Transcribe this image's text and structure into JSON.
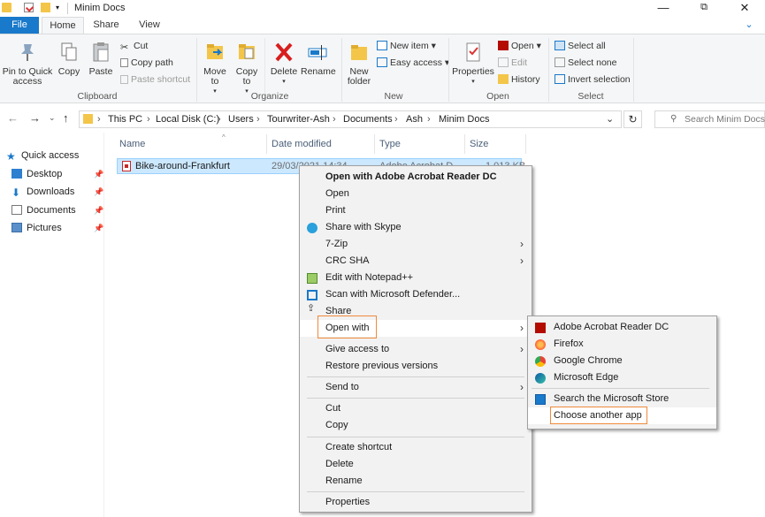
{
  "window": {
    "title": "Minim Docs",
    "controls": {
      "minimize": "—",
      "maximize": "⧉",
      "close": "✕"
    }
  },
  "tabs": [
    "File",
    "Home",
    "Share",
    "View"
  ],
  "ribbon": {
    "clipboard": {
      "label": "Clipboard",
      "pin": "Pin to Quick access",
      "copy": "Copy",
      "paste": "Paste",
      "cut": "Cut",
      "copy_path": "Copy path",
      "paste_shortcut": "Paste shortcut"
    },
    "organize": {
      "label": "Organize",
      "move_to": "Move to",
      "copy_to": "Copy to",
      "delete": "Delete",
      "rename": "Rename"
    },
    "new": {
      "label": "New",
      "new_folder": "New folder",
      "new_item": "New item",
      "easy_access": "Easy access"
    },
    "open": {
      "label": "Open",
      "properties": "Properties",
      "open": "Open",
      "edit": "Edit",
      "history": "History"
    },
    "select": {
      "label": "Select",
      "select_all": "Select all",
      "select_none": "Select none",
      "invert": "Invert selection"
    }
  },
  "address": {
    "crumbs": [
      "This PC",
      "Local Disk (C:)",
      "Users",
      "Tourwriter-Ash",
      "Documents",
      "Ash",
      "Minim Docs"
    ],
    "search_placeholder": "Search Minim Docs"
  },
  "nav": {
    "quick_access": "Quick access",
    "items": [
      "Desktop",
      "Downloads",
      "Documents",
      "Pictures"
    ]
  },
  "columns": {
    "name": "Name",
    "date": "Date modified",
    "type": "Type",
    "size": "Size"
  },
  "file": {
    "name": "Bike-around-Frankfurt",
    "date": "29/03/2021 14:34",
    "type": "Adobe Acrobat D",
    "size": "1,013 KB"
  },
  "context_menu": {
    "items": [
      "Open with Adobe Acrobat Reader DC",
      "Open",
      "Print",
      "Share with Skype",
      "7-Zip",
      "CRC SHA",
      "Edit with Notepad++",
      "Scan with Microsoft Defender...",
      "Share",
      "Open with",
      "Give access to",
      "Restore previous versions",
      "Send to",
      "Cut",
      "Copy",
      "Create shortcut",
      "Delete",
      "Rename",
      "Properties"
    ]
  },
  "submenu": {
    "items": [
      "Adobe Acrobat Reader DC",
      "Firefox",
      "Google Chrome",
      "Microsoft Edge",
      "Search the Microsoft Store",
      "Choose another app"
    ]
  },
  "colors": {
    "accent": "#1979ca",
    "selection": "#cce8ff",
    "highlight": "#ef8a3a"
  }
}
